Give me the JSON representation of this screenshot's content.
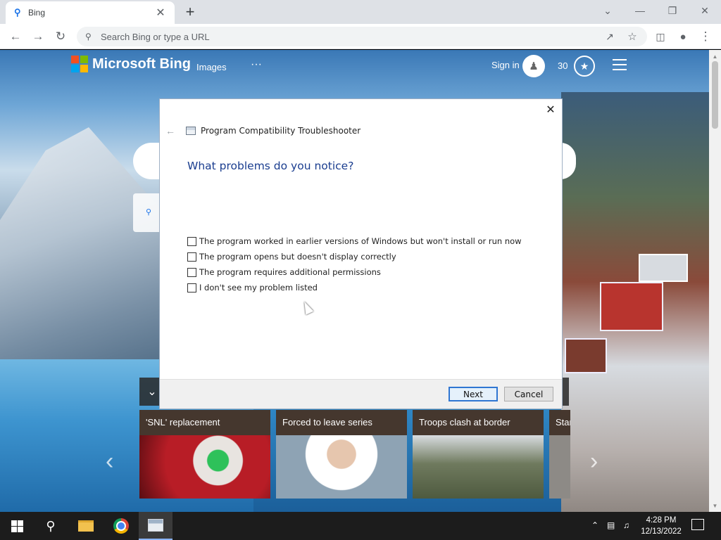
{
  "browser": {
    "tab": {
      "title": "Bing",
      "favicon": "search-icon"
    },
    "omnibox": {
      "placeholder": "Search Bing or type a URL"
    }
  },
  "bing": {
    "logo_text": "Microsoft Bing",
    "nav": {
      "images": "Images",
      "more": "···"
    },
    "sign_in": "Sign in",
    "points": "30",
    "colors": {
      "ms_red": "#f25022",
      "ms_green": "#7fba00",
      "ms_blue": "#00a4ef",
      "ms_yellow": "#ffb900"
    }
  },
  "news": {
    "cards": [
      {
        "title": "'SNL' replacement"
      },
      {
        "title": "Forced to leave series"
      },
      {
        "title": "Troops clash at border"
      },
      {
        "title": "Star"
      }
    ]
  },
  "dialog": {
    "app_title": "Program Compatibility Troubleshooter",
    "question": "What problems do you notice?",
    "options": [
      {
        "label": "The program worked in earlier versions of Windows but won't install or run now",
        "checked": false
      },
      {
        "label": "The program opens but doesn't display correctly",
        "checked": false
      },
      {
        "label": "The program requires additional permissions",
        "checked": false
      },
      {
        "label": "I don't see my problem listed",
        "checked": false
      }
    ],
    "buttons": {
      "next": "Next",
      "cancel": "Cancel"
    },
    "accent": "#1a3d8f"
  },
  "taskbar": {
    "clock_time": "4:28 PM",
    "clock_date": "12/13/2022"
  }
}
